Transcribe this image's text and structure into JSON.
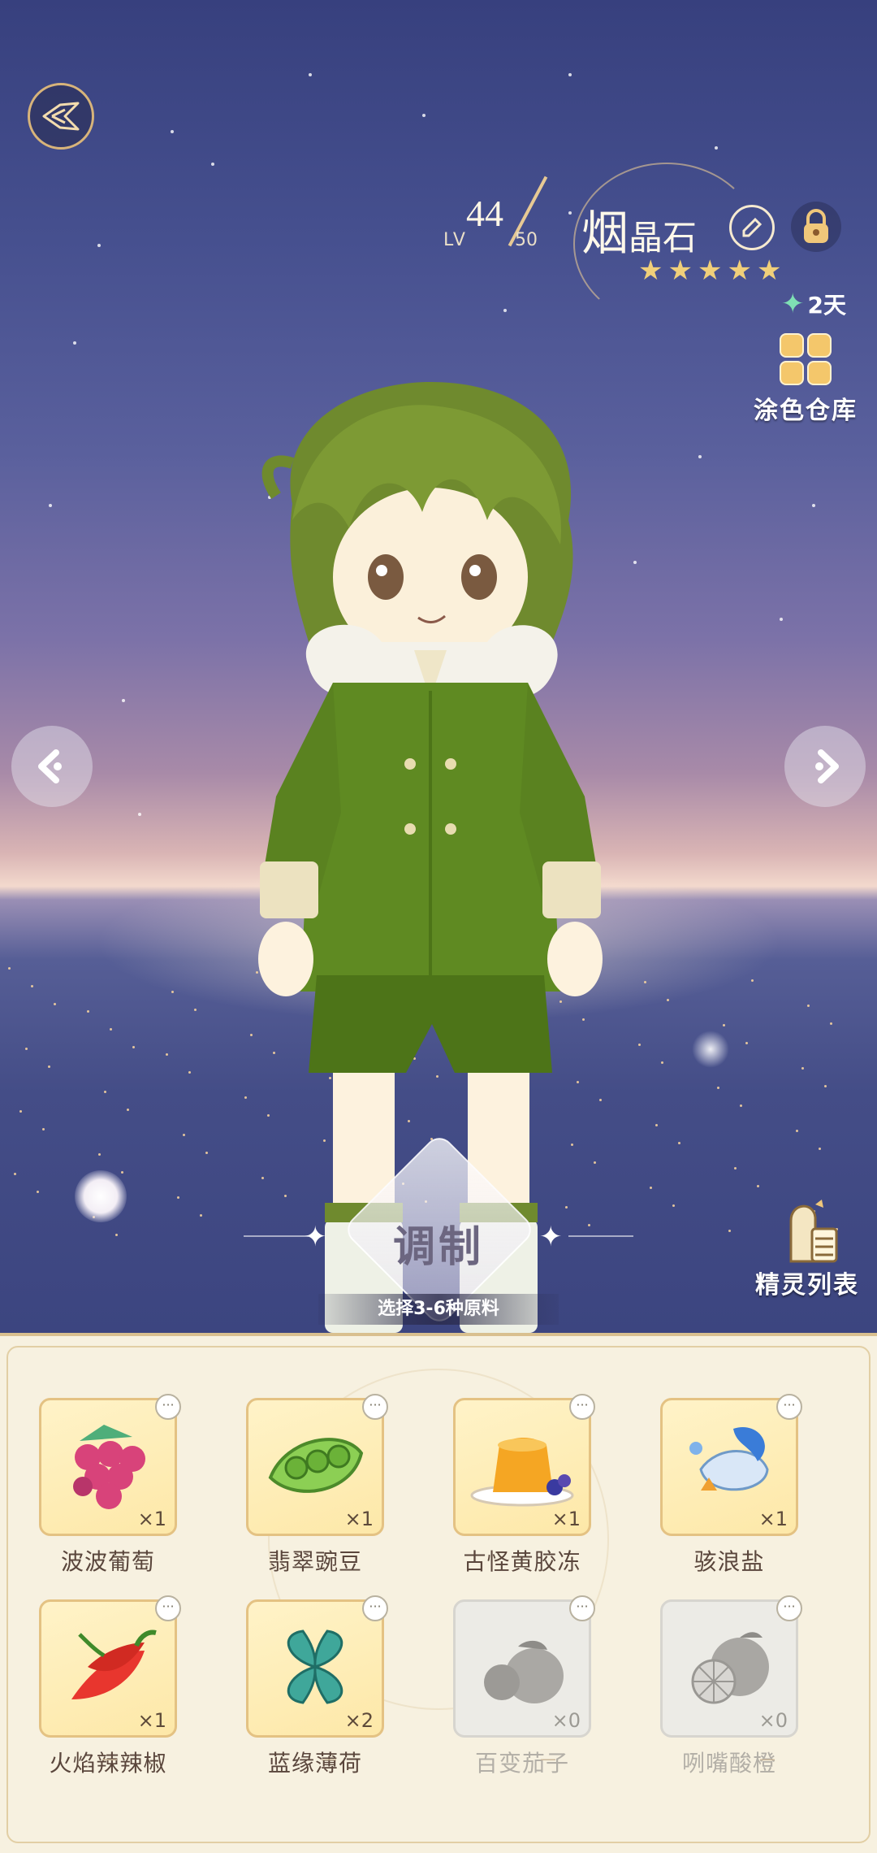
{
  "level": {
    "prefix": "LV",
    "current": "44",
    "max": "50"
  },
  "character": {
    "name_first": "烟",
    "name_rest": "晶石",
    "rarity_stars": 5
  },
  "day_badge": {
    "text": "2天"
  },
  "paint_storage": {
    "label": "涂色仓库"
  },
  "craft": {
    "label": "调制",
    "hint": "选择3-6种原料"
  },
  "spirit_list": {
    "label": "精灵列表"
  },
  "ingredients": [
    {
      "name": "波波葡萄",
      "count": "×1",
      "icon": "grape-icon",
      "available": true
    },
    {
      "name": "翡翠豌豆",
      "count": "×1",
      "icon": "pea-icon",
      "available": true
    },
    {
      "name": "古怪黄胶冻",
      "count": "×1",
      "icon": "jelly-icon",
      "available": true
    },
    {
      "name": "骇浪盐",
      "count": "×1",
      "icon": "salt-icon",
      "available": true
    },
    {
      "name": "火焰辣辣椒",
      "count": "×1",
      "icon": "chili-icon",
      "available": true
    },
    {
      "name": "蓝缘薄荷",
      "count": "×2",
      "icon": "mint-icon",
      "available": true
    },
    {
      "name": "百变茄子",
      "count": "×0",
      "icon": "eggplant-icon",
      "available": false
    },
    {
      "name": "咧嘴酸橙",
      "count": "×0",
      "icon": "orange-icon",
      "available": false
    }
  ],
  "more_glyph": "···",
  "colors": {
    "accent_gold": "#e4c283",
    "panel_bg": "#f7f1e0",
    "sky_top": "#37407e"
  }
}
